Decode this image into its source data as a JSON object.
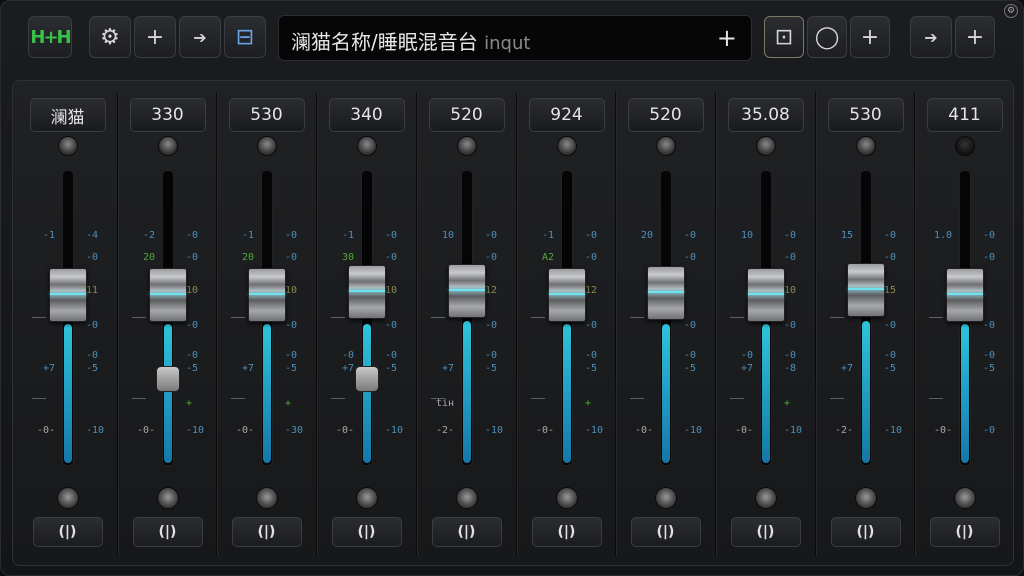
{
  "toolbar": {
    "buttons": [
      {
        "name": "meter-button",
        "icon": "meter-icon",
        "glyph": "H+H"
      },
      {
        "name": "settings-button",
        "icon": "gear-icon",
        "glyph": "⚙"
      },
      {
        "name": "add-button",
        "icon": "plus-icon",
        "glyph": "+"
      },
      {
        "name": "forward-button",
        "icon": "arrow-right-icon",
        "glyph": "➔"
      },
      {
        "name": "link-button",
        "icon": "link-icon",
        "glyph": "⊟"
      },
      {
        "name": "monitor-button",
        "icon": "monitor-icon",
        "glyph": "⊡"
      },
      {
        "name": "loop-button",
        "icon": "circle-icon",
        "glyph": "◯"
      },
      {
        "name": "add-track-button",
        "icon": "plus-icon",
        "glyph": "+"
      },
      {
        "name": "send-button",
        "icon": "arrow-right-icon",
        "glyph": "➔"
      },
      {
        "name": "split-button",
        "icon": "plus-icon",
        "glyph": "+"
      }
    ],
    "title": "澜猫名称/睡眠混音台",
    "title_placeholder": "inqut",
    "title_plus": "+",
    "corner_glyph": "⚙"
  },
  "channels": [
    {
      "label": "澜猫",
      "fill": 0.48
    },
    {
      "label": "330",
      "fill": 0.48
    },
    {
      "label": "530",
      "fill": 0.48
    },
    {
      "label": "340",
      "fill": 0.48
    },
    {
      "label": "520",
      "fill": 0.49
    },
    {
      "label": "924",
      "fill": 0.48
    },
    {
      "label": "520",
      "fill": 0.48
    },
    {
      "label": "35.08",
      "fill": 0.48
    },
    {
      "label": "530",
      "fill": 0.49
    },
    {
      "label": "411",
      "fill": 0.48
    }
  ],
  "pan_glyph": "(|)",
  "scales": [
    {
      "left": [
        "-1",
        "",
        "",
        "",
        "",
        "+7",
        "",
        "-0-"
      ],
      "left_g": "",
      "right": [
        "-4",
        "-0",
        "11",
        "-0",
        "-0",
        "-5",
        "",
        "-10"
      ],
      "extra": ""
    },
    {
      "left": [
        "-2",
        "20",
        "",
        "",
        "",
        "",
        "",
        "-0-"
      ],
      "left_g": "20",
      "right": [
        "-0",
        "-0",
        "10",
        "-0",
        "-0",
        "-5",
        "+",
        "-10"
      ],
      "extra": ""
    },
    {
      "left": [
        "-1",
        "20",
        "",
        "",
        "",
        "+7",
        "",
        "-0-"
      ],
      "left_g": "20",
      "right": [
        "-0",
        "-0",
        "10",
        "-0",
        "-0",
        "-5",
        "+",
        "-30"
      ],
      "extra": ""
    },
    {
      "left": [
        "-1",
        "30",
        "",
        "",
        "-0",
        "+7",
        "",
        "-0-"
      ],
      "left_g": "30",
      "right": [
        "-0",
        "-0",
        "10",
        "-0",
        "-0",
        "-5",
        "",
        "-10"
      ],
      "extra": ""
    },
    {
      "left": [
        "10",
        "",
        "",
        "",
        "",
        "+7",
        "tiн",
        "-2-"
      ],
      "left_g": "",
      "right": [
        "-0",
        "-0",
        "12",
        "-0",
        "-0",
        "-5",
        "",
        "-10"
      ],
      "extra": ""
    },
    {
      "left": [
        "-1",
        "A2",
        "",
        "",
        "",
        "",
        "",
        "-0-"
      ],
      "left_g": "A2",
      "right": [
        "-0",
        "-0",
        "12",
        "-0",
        "-0",
        "-5",
        "+",
        "-10"
      ],
      "extra": ""
    },
    {
      "left": [
        "20",
        "",
        "",
        "",
        "",
        "",
        "",
        "-0-"
      ],
      "left_g": "",
      "right": [
        "-0",
        "-0",
        "",
        "-0",
        "-0",
        "-5",
        "",
        "-10"
      ],
      "extra": ""
    },
    {
      "left": [
        "10",
        "",
        "",
        "",
        "-0",
        "+7",
        "",
        "-0-"
      ],
      "left_g": "",
      "right": [
        "-0",
        "-0",
        "10",
        "-0",
        "-0",
        "-8",
        "+",
        "-10"
      ],
      "extra": ""
    },
    {
      "left": [
        "15",
        "",
        "",
        "",
        "",
        "+7",
        "",
        "-2-"
      ],
      "left_g": "",
      "right": [
        "-0",
        "-0",
        "15",
        "-0",
        "-0",
        "-5",
        "",
        "-10"
      ],
      "extra": ""
    },
    {
      "left": [
        "1.0",
        "",
        "",
        "",
        "",
        "",
        "",
        "-0-"
      ],
      "left_g": "",
      "right": [
        "-0",
        "-0",
        "",
        "-0",
        "-0",
        "-5",
        "",
        "-0"
      ],
      "extra": ""
    }
  ]
}
